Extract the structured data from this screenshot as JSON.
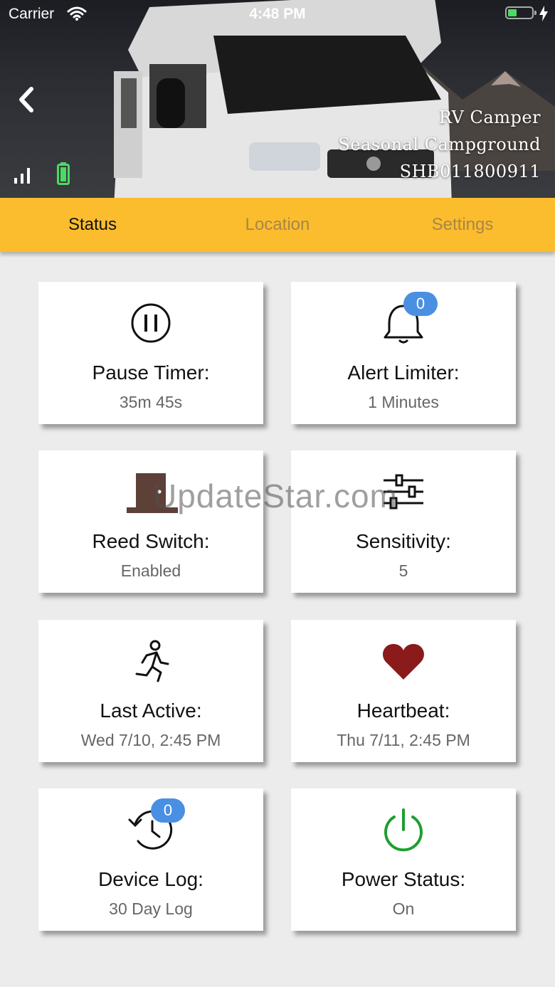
{
  "statusbar": {
    "carrier": "Carrier",
    "time": "4:48 PM"
  },
  "device": {
    "name": "RV Camper",
    "location": "Seasonal Campground",
    "serial": "SHB011800911"
  },
  "tabs": [
    {
      "label": "Status",
      "active": true
    },
    {
      "label": "Location",
      "active": false
    },
    {
      "label": "Settings",
      "active": false
    }
  ],
  "cards": {
    "pause_timer": {
      "title": "Pause Timer:",
      "value": "35m 45s",
      "icon": "pause-icon"
    },
    "alert_limiter": {
      "title": "Alert Limiter:",
      "value": "1 Minutes",
      "icon": "bell-icon",
      "badge": "0"
    },
    "reed_switch": {
      "title": "Reed Switch:",
      "value": "Enabled",
      "icon": "door-icon"
    },
    "sensitivity": {
      "title": "Sensitivity:",
      "value": "5",
      "icon": "sliders-icon"
    },
    "last_active": {
      "title": "Last Active:",
      "value": "Wed 7/10, 2:45 PM",
      "icon": "running-person-icon"
    },
    "heartbeat": {
      "title": "Heartbeat:",
      "value": "Thu 7/11, 2:45 PM",
      "icon": "heart-icon"
    },
    "device_log": {
      "title": "Device Log:",
      "value": "30 Day Log",
      "icon": "history-icon",
      "badge": "0"
    },
    "power_status": {
      "title": "Power Status:",
      "value": "On",
      "icon": "power-icon"
    }
  },
  "watermark": "UpdateStar.com",
  "colors": {
    "tab_bar": "#fbbd2e",
    "badge": "#4a90e2",
    "heart": "#8b1a1a",
    "power": "#1e9e2e",
    "door": "#5d4037"
  }
}
